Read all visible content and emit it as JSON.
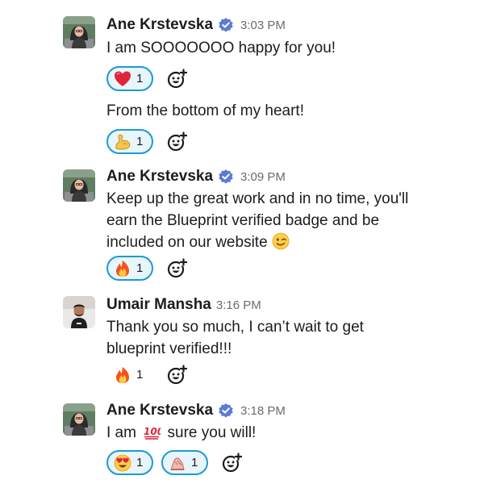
{
  "messages": [
    {
      "author": "Ane Krstevska",
      "time": "3:03 PM",
      "verified": true,
      "lines": [
        "I am SOOOOOOO happy for you!"
      ],
      "reactions": [
        {
          "icon": "red-heart",
          "count": "1",
          "selected": true
        }
      ],
      "followups": [
        {
          "text": "From the bottom of my heart!",
          "reactions": [
            {
              "icon": "flexed-biceps",
              "count": "1",
              "selected": true
            }
          ]
        }
      ]
    },
    {
      "author": "Ane Krstevska",
      "time": "3:09 PM",
      "verified": true,
      "lines": [
        "Keep up the great work and in no time, you'll",
        "earn the Blueprint verified badge and be",
        "included on our website"
      ],
      "trailing_emoji": "winking-face",
      "reactions": [
        {
          "icon": "fire",
          "count": "1",
          "selected": true
        }
      ]
    },
    {
      "author": "Umair Mansha",
      "time": "3:16 PM",
      "verified": false,
      "lines": [
        "Thank you so much, I can’t wait to get",
        "blueprint verified!!!"
      ],
      "reactions": [
        {
          "icon": "fire",
          "count": "1",
          "selected": false
        }
      ]
    },
    {
      "author": "Ane Krstevska",
      "time": "3:18 PM",
      "verified": true,
      "text_before": "I am",
      "inline_emoji": "hundred-points",
      "text_after": "sure you will!",
      "reactions": [
        {
          "icon": "heart-eyes",
          "count": "1",
          "selected": true
        },
        {
          "icon": "custom-sloth",
          "count": "1",
          "selected": true
        }
      ]
    }
  ],
  "icons": {
    "add_reaction": "add-reaction-icon",
    "verified": "verified-badge-icon"
  },
  "colors": {
    "accent": "#1d9bd1",
    "verified": "#5b7bd5",
    "pill_bg": "#e8f5fa"
  }
}
